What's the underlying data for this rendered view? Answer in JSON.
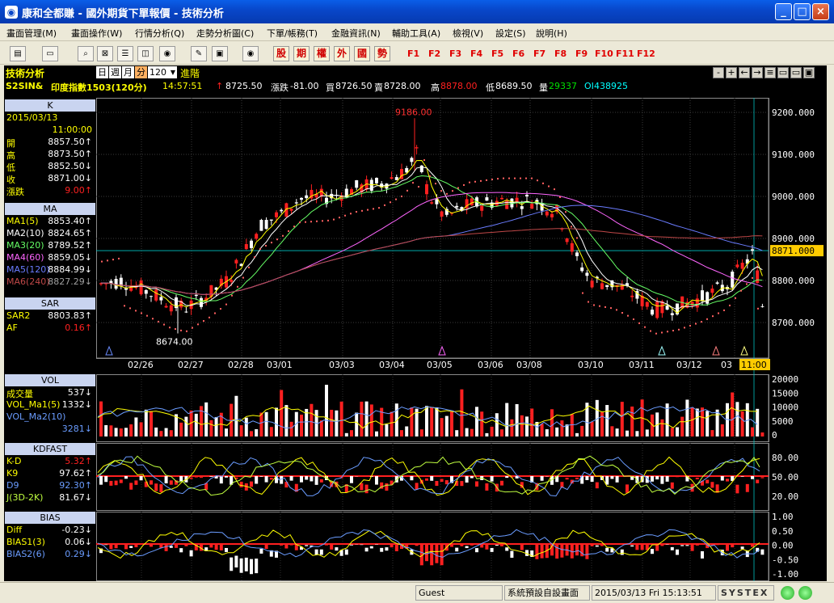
{
  "window": {
    "title": "康和全都賺 - 國外期貨下單報價 - 技術分析",
    "btn_min": "_",
    "btn_max": "□",
    "btn_close": "×"
  },
  "menu": [
    "畫面管理(M)",
    "畫面操作(W)",
    "行情分析(Q)",
    "走勢分析圖(C)",
    "下單/帳務(T)",
    "金融資訊(N)",
    "輔助工具(A)",
    "檢視(V)",
    "設定(S)",
    "說明(H)"
  ],
  "toolbar": {
    "cn_buttons": [
      "股",
      "期",
      "權",
      "外",
      "國",
      "勢"
    ],
    "fkeys": [
      "F1",
      "F2",
      "F3",
      "F4",
      "F5",
      "F6",
      "F7",
      "F8",
      "F9",
      "F10",
      "F11",
      "F12"
    ]
  },
  "panel_header": {
    "title": "技術分析",
    "periods": [
      "日",
      "週",
      "月",
      "分"
    ],
    "period_count": "120",
    "advanced": "進階",
    "controls": [
      "-",
      "+",
      "←",
      "→",
      "≡",
      "▭",
      "▭",
      "▣"
    ]
  },
  "quote": {
    "symbol": "S2SIN&",
    "name": "印度指數1503(120分)",
    "time": "14:57:51",
    "arrow": "↑",
    "last": "8725.50",
    "change_label": "漲跌",
    "change": "-81.00",
    "bid_label": "買",
    "bid": "8726.50",
    "ask_label": "賣",
    "ask": "8728.00",
    "high_label": "高",
    "high": "8878.00",
    "low_label": "低",
    "low": "8689.50",
    "vol_label": "量",
    "vol": "29337",
    "oi_label": "OI",
    "oi": "438925"
  },
  "left_panel": {
    "k": {
      "title": "K",
      "date": "2015/03/13",
      "time": "11:00:00",
      "rows": [
        {
          "k": "開",
          "v": "8857.50↑"
        },
        {
          "k": "高",
          "v": "8873.50↑"
        },
        {
          "k": "低",
          "v": "8852.50↓"
        },
        {
          "k": "收",
          "v": "8871.00↓"
        },
        {
          "k": "漲跌",
          "v": "9.00↑"
        }
      ]
    },
    "ma": {
      "title": "MA",
      "rows": [
        {
          "k": "MA1(5)",
          "v": "8853.40↑"
        },
        {
          "k": "MA2(10)",
          "v": "8824.65↑"
        },
        {
          "k": "MA3(20)",
          "v": "8789.52↑"
        },
        {
          "k": "MA4(60)",
          "v": "8859.05↓"
        },
        {
          "k": "MA5(120)",
          "v": "8884.99↓"
        },
        {
          "k": "MA6(240)",
          "v": "8827.29↓"
        }
      ]
    },
    "sar": {
      "title": "SAR",
      "rows": [
        {
          "k": "SAR2",
          "v": "8803.83↑"
        },
        {
          "k": "AF",
          "v": "0.16↑"
        }
      ]
    },
    "vol": {
      "title": "VOL",
      "rows": [
        {
          "k": "成交量",
          "v": "537↓"
        },
        {
          "k": "VOL_Ma1(5)",
          "v": "1332↓"
        },
        {
          "k": "VOL_Ma2(10)",
          "v": ""
        },
        {
          "k": "",
          "v": "3281↓"
        }
      ]
    },
    "kd": {
      "title": "KDFAST",
      "rows": [
        {
          "k": "K-D",
          "v": "5.32↑"
        },
        {
          "k": "K9",
          "v": "97.62↑"
        },
        {
          "k": "D9",
          "v": "92.30↑"
        },
        {
          "k": "J(3D-2K)",
          "v": "81.67↓"
        }
      ]
    },
    "bias": {
      "title": "BIAS",
      "rows": [
        {
          "k": "Diff",
          "v": "-0.23↓"
        },
        {
          "k": "BIAS1(3)",
          "v": "0.06↓"
        },
        {
          "k": "BIAS2(6)",
          "v": "0.29↓"
        }
      ]
    }
  },
  "price_chart": {
    "y_ticks": [
      "9200.000",
      "9100.000",
      "9000.000",
      "8900.000",
      "8800.000",
      "8700.000"
    ],
    "current_price": "8871.000",
    "high_annotation": "9186.00",
    "low_annotation": "8674.00",
    "date_labels": [
      "02/26",
      "02/27",
      "02/28",
      "03/01",
      "03/03",
      "03/04",
      "03/05",
      "03/06",
      "03/08",
      "03/10",
      "03/11",
      "03/12",
      "03"
    ],
    "cursor_time": "11:00"
  },
  "vol_chart": {
    "y_ticks": [
      "20000",
      "15000",
      "10000",
      "5000",
      "0"
    ]
  },
  "kd_chart": {
    "y_ticks": [
      "80.00",
      "50.00",
      "20.00"
    ]
  },
  "bias_chart": {
    "y_ticks": [
      "1.00",
      "0.50",
      "0.00",
      "-0.50",
      "-1.00"
    ]
  },
  "status": {
    "user": "Guest",
    "layout": "系統預設自設畫面",
    "datetime": "2015/03/13 Fri 15:13:51",
    "brand": "SYSTEX"
  },
  "colors": {
    "up": "#ff2020",
    "down": "#ffffff",
    "yellow": "#ffff00",
    "cyan": "#00ffff",
    "titlebar": "#0846c8"
  }
}
